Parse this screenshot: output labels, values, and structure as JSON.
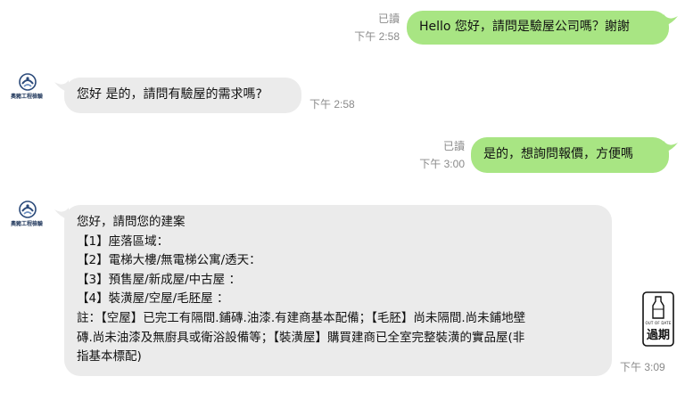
{
  "messages": [
    {
      "direction": "outgoing",
      "read_status": "已讀",
      "time": "下午 2:58",
      "text": "Hello 您好，請問是驗屋公司嗎？謝謝"
    },
    {
      "direction": "incoming",
      "sender_logo_text": "奧豬工程檢驗",
      "time": "下午 2:58",
      "text": "您好  是的，請問有驗屋的需求嗎?"
    },
    {
      "direction": "outgoing",
      "read_status": "已讀",
      "time": "下午 3:00",
      "text": "是的，想詢問報價，方便嗎"
    },
    {
      "direction": "incoming",
      "sender_logo_text": "奧豬工程檢驗",
      "time": "下午 3:09",
      "lines": [
        "您好，請問您的建案",
        "【1】座落區域：",
        "【2】電梯大樓/無電梯公寓/透天：",
        "【3】預售屋/新成屋/中古屋 ：",
        "【4】裝潢屋/空屋/毛胚屋 ：",
        "註：【空屋】已完工有隔間.鋪磚.油漆.有建商基本配備；【毛胚】尚未隔間.尚未鋪地壁",
        "磚.尚未油漆及無廚具或衛浴設備等；【裝潢屋】購買建商已全室完整裝潢的實品屋(非",
        "指基本標配)"
      ]
    }
  ],
  "expired_badge": {
    "sub_text": "OUT OF DATE",
    "label": "過期",
    "icon": "milk-bottle-icon"
  },
  "colors": {
    "outgoing_bubble": "#a8e583",
    "incoming_bubble": "#ebebeb",
    "meta_text": "#8a8a8a",
    "logo_blue": "#2b4a7a"
  }
}
